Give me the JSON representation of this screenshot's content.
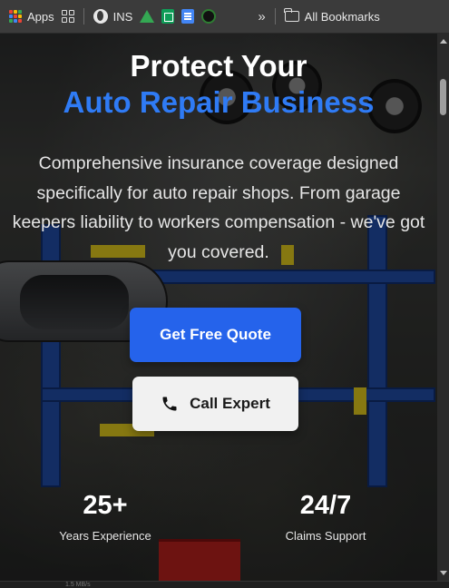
{
  "bookmarks": {
    "apps_label": "Apps",
    "ins_label": "INS",
    "overflow_label": "»",
    "all_bookmarks_label": "All Bookmarks"
  },
  "hero": {
    "title_line1": "Protect Your",
    "title_line2": "Auto Repair Business",
    "description": "Comprehensive insurance coverage designed specifically for auto repair shops. From garage keepers liability to workers compensation - we've got you covered.",
    "primary_button": "Get Free Quote",
    "secondary_button": "Call Expert"
  },
  "stats": [
    {
      "value": "25+",
      "label": "Years Experience"
    },
    {
      "value": "24/7",
      "label": "Claims Support"
    }
  ],
  "status_text": "1.5 MB/s",
  "colors": {
    "accent_blue": "#2563eb",
    "title_blue": "#2f7bf5",
    "call_button_bg": "#f1f1f1"
  }
}
